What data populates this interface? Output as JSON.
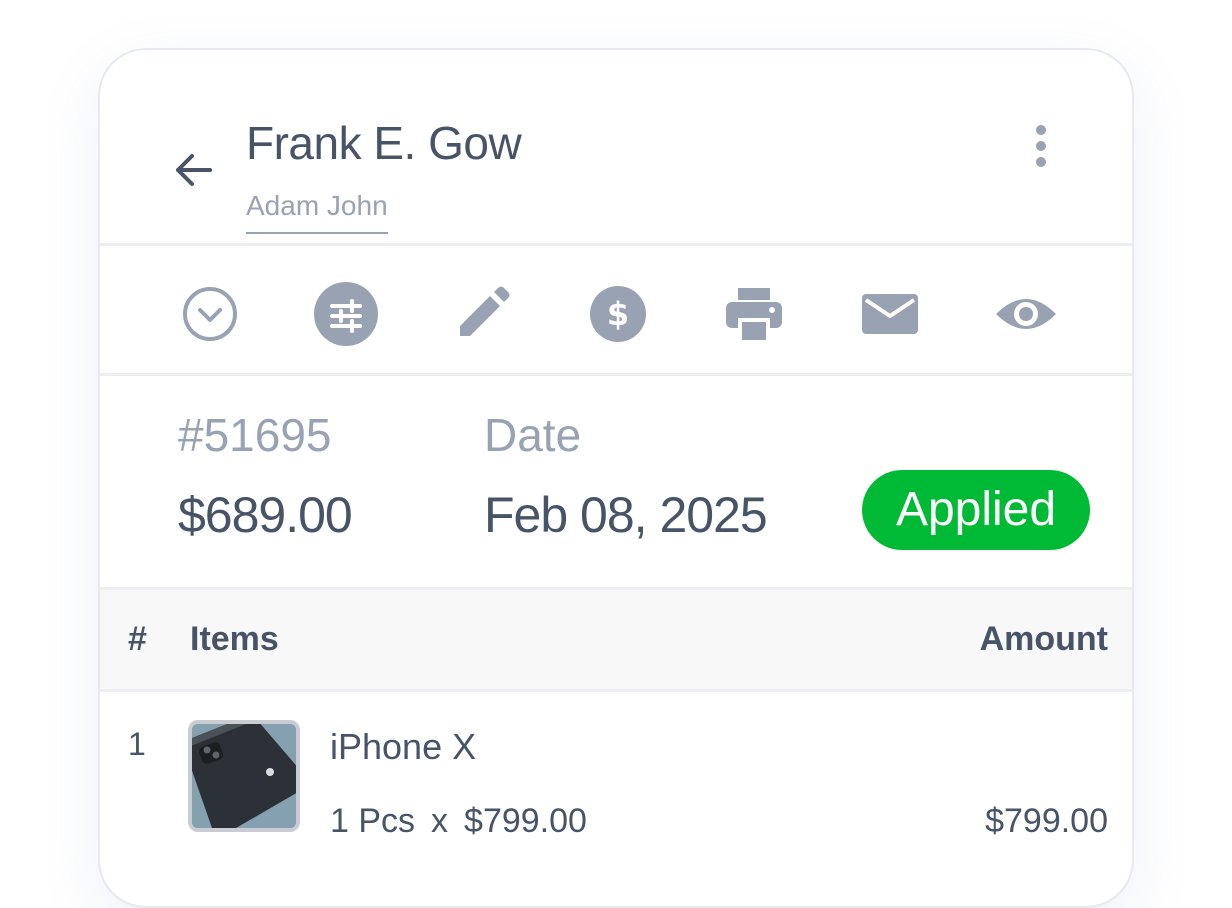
{
  "header": {
    "customer_name": "Frank E. Gow",
    "sub_name": "Adam John"
  },
  "toolbar": {
    "icons": [
      "chevron-down-circle-icon",
      "sliders-icon",
      "pencil-icon",
      "dollar-icon",
      "printer-icon",
      "mail-icon",
      "eye-icon"
    ],
    "icon_color": "#98a2b3"
  },
  "summary": {
    "invoice_number": "#51695",
    "total_amount": "$689.00",
    "date_label": "Date",
    "date_value": "Feb 08, 2025",
    "status": "Applied",
    "status_color": "#00b934"
  },
  "table": {
    "columns": {
      "index": "#",
      "items": "Items",
      "amount": "Amount"
    },
    "rows": [
      {
        "index": "1",
        "name": "iPhone X",
        "qty": "1 Pcs",
        "times": "x",
        "unit_price": "$799.00",
        "amount": "$799.00"
      }
    ]
  }
}
